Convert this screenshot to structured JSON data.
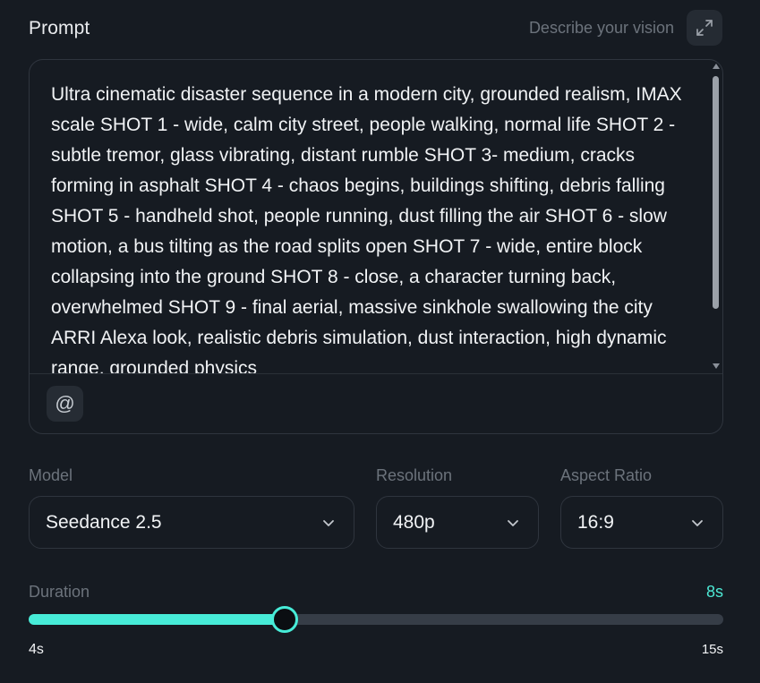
{
  "prompt": {
    "label": "Prompt",
    "hint": "Describe your vision",
    "text": "Ultra cinematic disaster sequence in a modern city, grounded realism, IMAX scale SHOT 1 - wide, calm city street, people walking, normal life SHOT 2 - subtle tremor, glass vibrating, distant rumble SHOT 3- medium, cracks forming in asphalt SHOT 4 - chaos begins, buildings shifting, debris falling SHOT 5 - handheld shot, people running, dust filling the air SHOT 6 - slow motion, a bus tilting as the road splits open SHOT 7 - wide, entire block collapsing into the ground SHOT 8 - close, a character turning back, overwhelmed SHOT 9 - final aerial, massive sinkhole swallowing the city ARRI Alexa look, realistic debris simulation, dust interaction, high dynamic range, grounded physics",
    "mention_symbol": "@",
    "expand_icon": "expand-arrows-icon"
  },
  "model": {
    "label": "Model",
    "value": "Seedance 2.5"
  },
  "resolution": {
    "label": "Resolution",
    "value": "480p"
  },
  "aspect_ratio": {
    "label": "Aspect Ratio",
    "value": "16:9"
  },
  "duration": {
    "label": "Duration",
    "value_label": "8s",
    "min_label": "4s",
    "max_label": "15s",
    "min": 4,
    "max": 15,
    "value": 8,
    "slider_fraction": 0.368
  },
  "colors": {
    "accent": "#47ecd8",
    "background": "#161b22",
    "border": "#2f353e",
    "muted_text": "#6c737c"
  }
}
